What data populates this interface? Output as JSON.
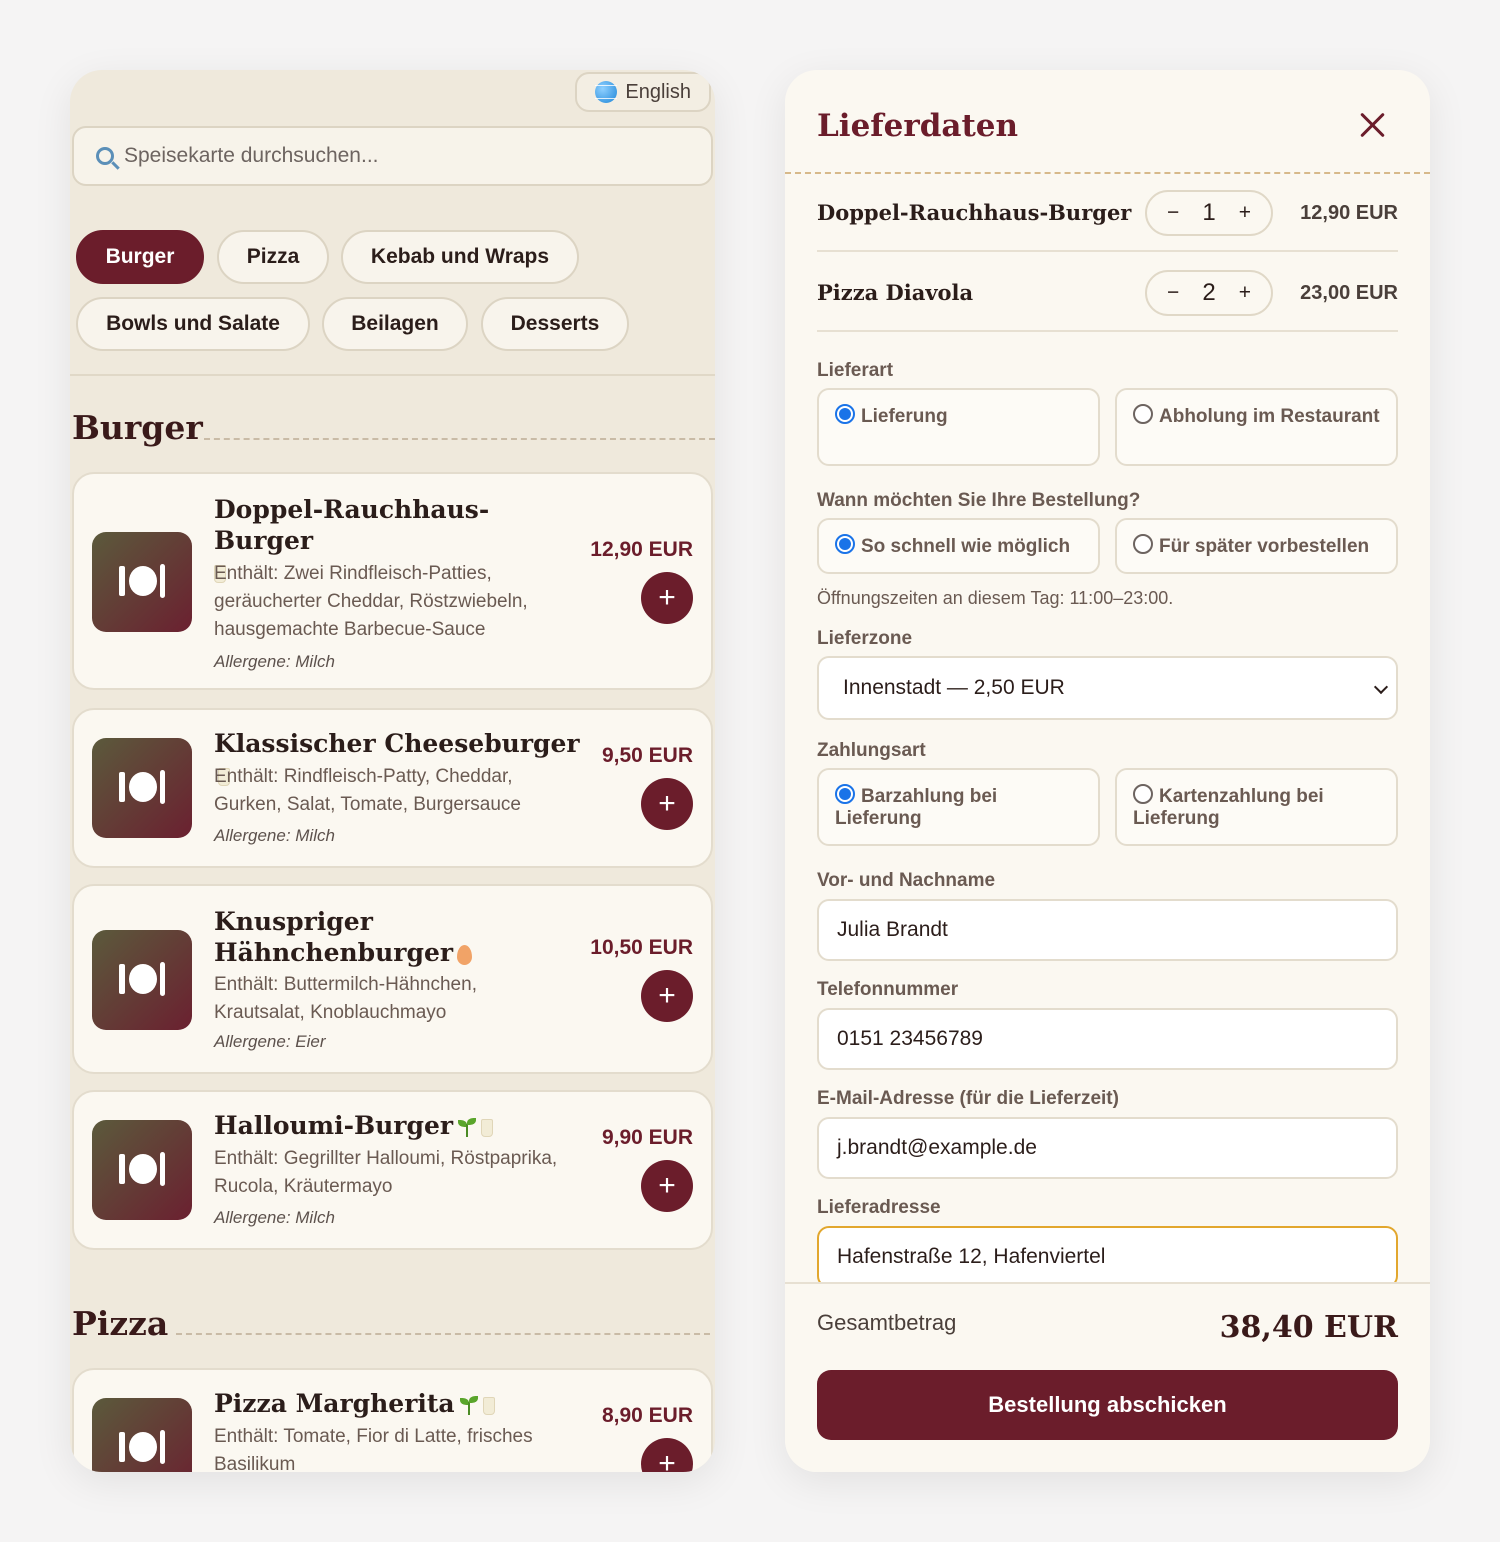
{
  "menu": {
    "language": "English",
    "search_placeholder": "Speisekarte durchsuchen...",
    "categories": [
      "Burger",
      "Pizza",
      "Kebab und Wraps",
      "Bowls und Salate",
      "Beilagen",
      "Desserts"
    ],
    "active_category": "Burger",
    "sections": [
      {
        "title": "Burger",
        "items": [
          {
            "name": "Doppel-Rauchhaus-Burger",
            "price": "12,90 EUR",
            "ingredients": "Enthält: Zwei Rindfleisch-Patties, geräucherter Cheddar, Röstzwiebeln, hausgemachte Barbecue-Sauce",
            "allergens": "Allergene: Milch",
            "tags": [
              "milk"
            ]
          },
          {
            "name": "Klassischer Cheeseburger",
            "price": "9,50 EUR",
            "ingredients": "Enthält: Rindfleisch-Patty, Cheddar, Gurken, Salat, Tomate, Burgersauce",
            "allergens": "Allergene: Milch",
            "tags": [
              "milk"
            ]
          },
          {
            "name": "Knuspriger Hähnchenburger",
            "price": "10,50 EUR",
            "ingredients": "Enthält: Buttermilch-Hähnchen, Krautsalat, Knoblauchmayo",
            "allergens": "Allergene: Eier",
            "tags": [
              "egg"
            ]
          },
          {
            "name": "Halloumi-Burger",
            "price": "9,90 EUR",
            "ingredients": "Enthält: Gegrillter Halloumi, Röstpaprika, Rucola, Kräutermayo",
            "allergens": "Allergene: Milch",
            "tags": [
              "vegetarian",
              "milk"
            ]
          }
        ]
      },
      {
        "title": "Pizza",
        "items": [
          {
            "name": "Pizza Margherita",
            "price": "8,90 EUR",
            "ingredients": "Enthält: Tomate, Fior di Latte, frisches Basilikum",
            "tags": [
              "vegetarian",
              "milk"
            ]
          }
        ]
      }
    ],
    "add_label": "+"
  },
  "checkout": {
    "title": "Lieferdaten",
    "cart": [
      {
        "name": "Doppel-Rauchhaus-Burger",
        "qty": "1",
        "price": "12,90 EUR"
      },
      {
        "name": "Pizza Diavola",
        "qty": "2",
        "price": "23,00 EUR"
      }
    ],
    "stepper_minus": "−",
    "stepper_plus": "+",
    "delivery_type": {
      "label": "Lieferart",
      "options": [
        "Lieferung",
        "Abholung im Restaurant"
      ],
      "selected": "Lieferung"
    },
    "timing": {
      "label": "Wann möchten Sie Ihre Bestellung?",
      "options": [
        "So schnell wie möglich",
        "Für später vorbestellen"
      ],
      "selected": "So schnell wie möglich"
    },
    "opening_hours": "Öffnungszeiten an diesem Tag: 11:00–23:00.",
    "zone": {
      "label": "Lieferzone",
      "value": "Innenstadt — 2,50 EUR"
    },
    "payment": {
      "label": "Zahlungsart",
      "options": [
        "Barzahlung bei Lieferung",
        "Kartenzahlung bei Lieferung"
      ],
      "selected": "Barzahlung bei Lieferung"
    },
    "fields": [
      {
        "label": "Vor- und Nachname",
        "value": "Julia Brandt"
      },
      {
        "label": "Telefonnummer",
        "value": "0151 23456789"
      },
      {
        "label": "E-Mail-Adresse (für die Lieferzeit)",
        "value": "j.brandt@example.de"
      },
      {
        "label": "Lieferadresse",
        "value": "Hafenstraße 12, Hafenviertel"
      }
    ],
    "total_label": "Gesamtbetrag",
    "total_value": "38,40 EUR",
    "submit_label": "Bestellung abschicken"
  },
  "colors": {
    "brand": "#6b1d2b",
    "focus": "#e2a72e",
    "radio": "#1a73e8"
  }
}
